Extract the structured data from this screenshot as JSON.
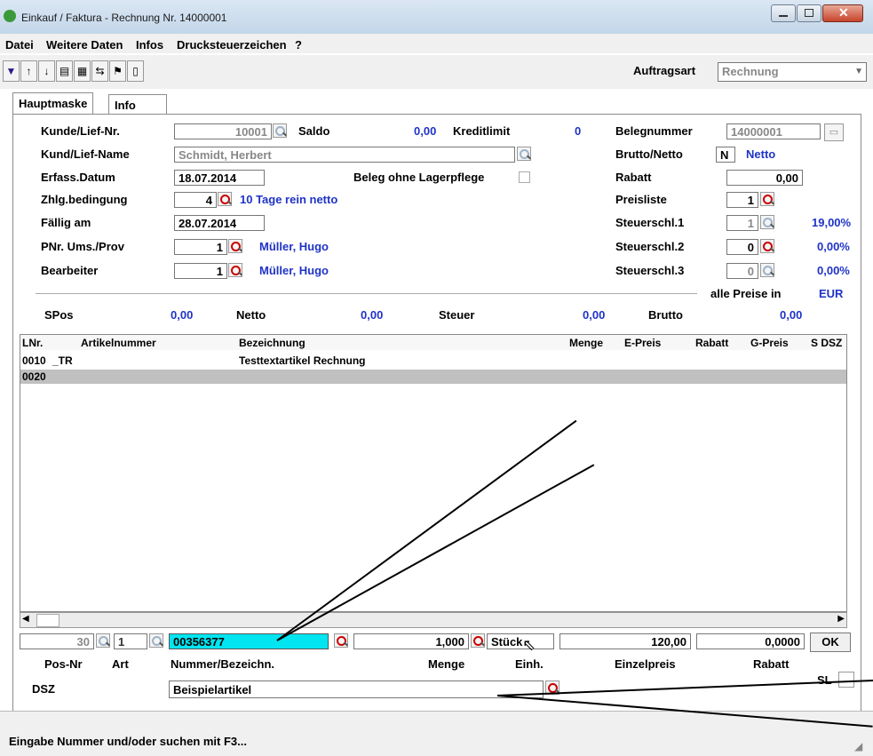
{
  "window": {
    "title": "Einkauf / Faktura - Rechnung Nr. 14000001"
  },
  "menu": [
    "Datei",
    "Weitere Daten",
    "Infos",
    "Drucksteuerzeichen",
    "?"
  ],
  "toolbar": {
    "auftragsart_label": "Auftragsart",
    "auftragsart_value": "Rechnung"
  },
  "tabs": [
    "Hauptmaske",
    "Info"
  ],
  "header": {
    "kunde_label": "Kunde/Lief-Nr.",
    "kunde_value": "10001",
    "saldo_label": "Saldo",
    "saldo_value": "0,00",
    "kreditlimit_label": "Kreditlimit",
    "kreditlimit_value": "0",
    "name_label": "Kund/Lief-Name",
    "name_value": "Schmidt, Herbert",
    "datum_label": "Erfass.Datum",
    "datum_value": "18.07.2014",
    "lagerpflege_label": "Beleg ohne Lagerpflege",
    "zahlung_label": "Zhlg.bedingung",
    "zahlung_value": "4",
    "zahlung_text": "10 Tage rein netto",
    "faellig_label": "Fällig am",
    "faellig_value": "28.07.2014",
    "prov_label": "PNr. Ums./Prov",
    "prov_value": "1",
    "prov_name": "Müller, Hugo",
    "bearbeiter_label": "Bearbeiter",
    "bearbeiter_value": "1",
    "bearbeiter_name": "Müller, Hugo",
    "belegnr_label": "Belegnummer",
    "belegnr_value": "14000001",
    "brutto_label": "Brutto/Netto",
    "brutto_value": "N",
    "brutto_text": "Netto",
    "rabatt_label": "Rabatt",
    "rabatt_value": "0,00",
    "preisliste_label": "Preisliste",
    "preisliste_value": "1",
    "st1_label": "Steuerschl.1",
    "st1_value": "1",
    "st1_pct": "19,00%",
    "st2_label": "Steuerschl.2",
    "st2_value": "0",
    "st2_pct": "0,00%",
    "st3_label": "Steuerschl.3",
    "st3_value": "0",
    "st3_pct": "0,00%",
    "preise_label": "alle Preise in",
    "preise_currency": "EUR"
  },
  "totals": {
    "spos_label": "SPos",
    "spos_value": "0,00",
    "netto_label": "Netto",
    "netto_value": "0,00",
    "steuer_label": "Steuer",
    "steuer_value": "0,00",
    "brutto_label": "Brutto",
    "brutto_value": "0,00"
  },
  "grid": {
    "columns": [
      "LNr.",
      "Artikelnummer",
      "Bezeichnung",
      "Menge",
      "E-Preis",
      "Rabatt",
      "G-Preis",
      "S DSZ"
    ],
    "rows": [
      {
        "lnr": "0010",
        "art": "_TR",
        "bez": "Testtextartikel Rechnung"
      },
      {
        "lnr": "0020",
        "art": "",
        "bez": ""
      }
    ]
  },
  "entry": {
    "posnr": "30",
    "art": "1",
    "nummer": "00356377",
    "menge": "1,000",
    "einheit": "Stück",
    "einzelpreis": "120,00",
    "rabatt": "0,0000",
    "ok_label": "OK",
    "posnr_label": "Pos-Nr",
    "art_label": "Art",
    "nummer_label": "Nummer/Bezeichn.",
    "menge_label": "Menge",
    "einheit_label": "Einh.",
    "einzelpreis_label": "Einzelpreis",
    "rabatt_label": "Rabatt",
    "sl_label": "SL",
    "dsz_label": "DSZ",
    "bezeichnung": "Beispielartikel"
  },
  "status": {
    "text": "Eingabe Nummer und/oder suchen mit F3..."
  },
  "colors": {
    "highlight": "#00e5f0",
    "accent": "#1f33c7",
    "row_selected": "#c0c0c0"
  }
}
